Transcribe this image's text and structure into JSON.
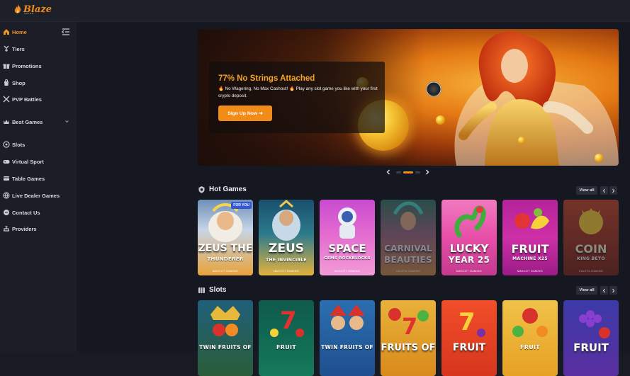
{
  "brand": {
    "name": "Blaze",
    "sub": "SPINS",
    "color": "#f08a1c"
  },
  "sidebar": {
    "items": [
      {
        "label": "Home",
        "icon": "home-icon",
        "active": true
      },
      {
        "label": "Tiers",
        "icon": "tiers-icon"
      },
      {
        "label": "Promotions",
        "icon": "promotions-icon"
      },
      {
        "label": "Shop",
        "icon": "shop-icon"
      },
      {
        "label": "PVP Battles",
        "icon": "swords-icon"
      },
      {
        "label": "Best Games",
        "icon": "crown-icon",
        "expandable": true
      },
      {
        "label": "Slots",
        "icon": "slots-icon"
      },
      {
        "label": "Virtual Sport",
        "icon": "gamepad-icon"
      },
      {
        "label": "Table Games",
        "icon": "cards-icon"
      },
      {
        "label": "Live Dealer Games",
        "icon": "globe-icon"
      },
      {
        "label": "Contact Us",
        "icon": "chat-icon"
      },
      {
        "label": "Providers",
        "icon": "providers-icon"
      }
    ]
  },
  "hero": {
    "title": "77% No Strings Attached",
    "description": "🔥 No Wagering, No Max Cashout! 🔥 Play any slot game you like with your first crypto deposit.",
    "cta": "Sign Up Now ➜",
    "accent": "#f28c18"
  },
  "slider": {
    "slides": 3,
    "active_index": 1
  },
  "hot_games": {
    "title": "Hot Games",
    "view_all": "View all",
    "games": [
      {
        "line1": "ZEUS THE",
        "line2": "THUNDERER",
        "studio": "MASCOT GAMING",
        "badge": "FOR YOU"
      },
      {
        "line1": "ZEUS",
        "line2": "THE INVINCIBLE",
        "studio": "MASCOT GAMING"
      },
      {
        "line1": "SPACE",
        "line2": "GEMS ROCKBLOCKS",
        "studio": "MASCOT GAMING"
      },
      {
        "line1": "CARNIVAL",
        "line2": "BEAUTIES",
        "studio": "CALETA GAMING"
      },
      {
        "line1": "LUCKY",
        "line2": "YEAR 25",
        "studio": "MASCOT GAMING"
      },
      {
        "line1": "FRUIT",
        "line2": "MACHINE X25",
        "studio": "MASCOT GAMING"
      },
      {
        "line1": "COIN",
        "line2": "KING BETO",
        "studio": "CALETA GAMING"
      }
    ]
  },
  "slots": {
    "title": "Slots",
    "view_all": "View all",
    "games": [
      {
        "line1": "TWIN FRUITS OF"
      },
      {
        "line1": "FRUIT"
      },
      {
        "line1": "TWIN FRUITS OF"
      },
      {
        "line1": "FRUITS OF"
      },
      {
        "line1": "FRUIT"
      },
      {
        "line1": "FRUIT"
      },
      {
        "line1": "FRUIT"
      }
    ]
  }
}
